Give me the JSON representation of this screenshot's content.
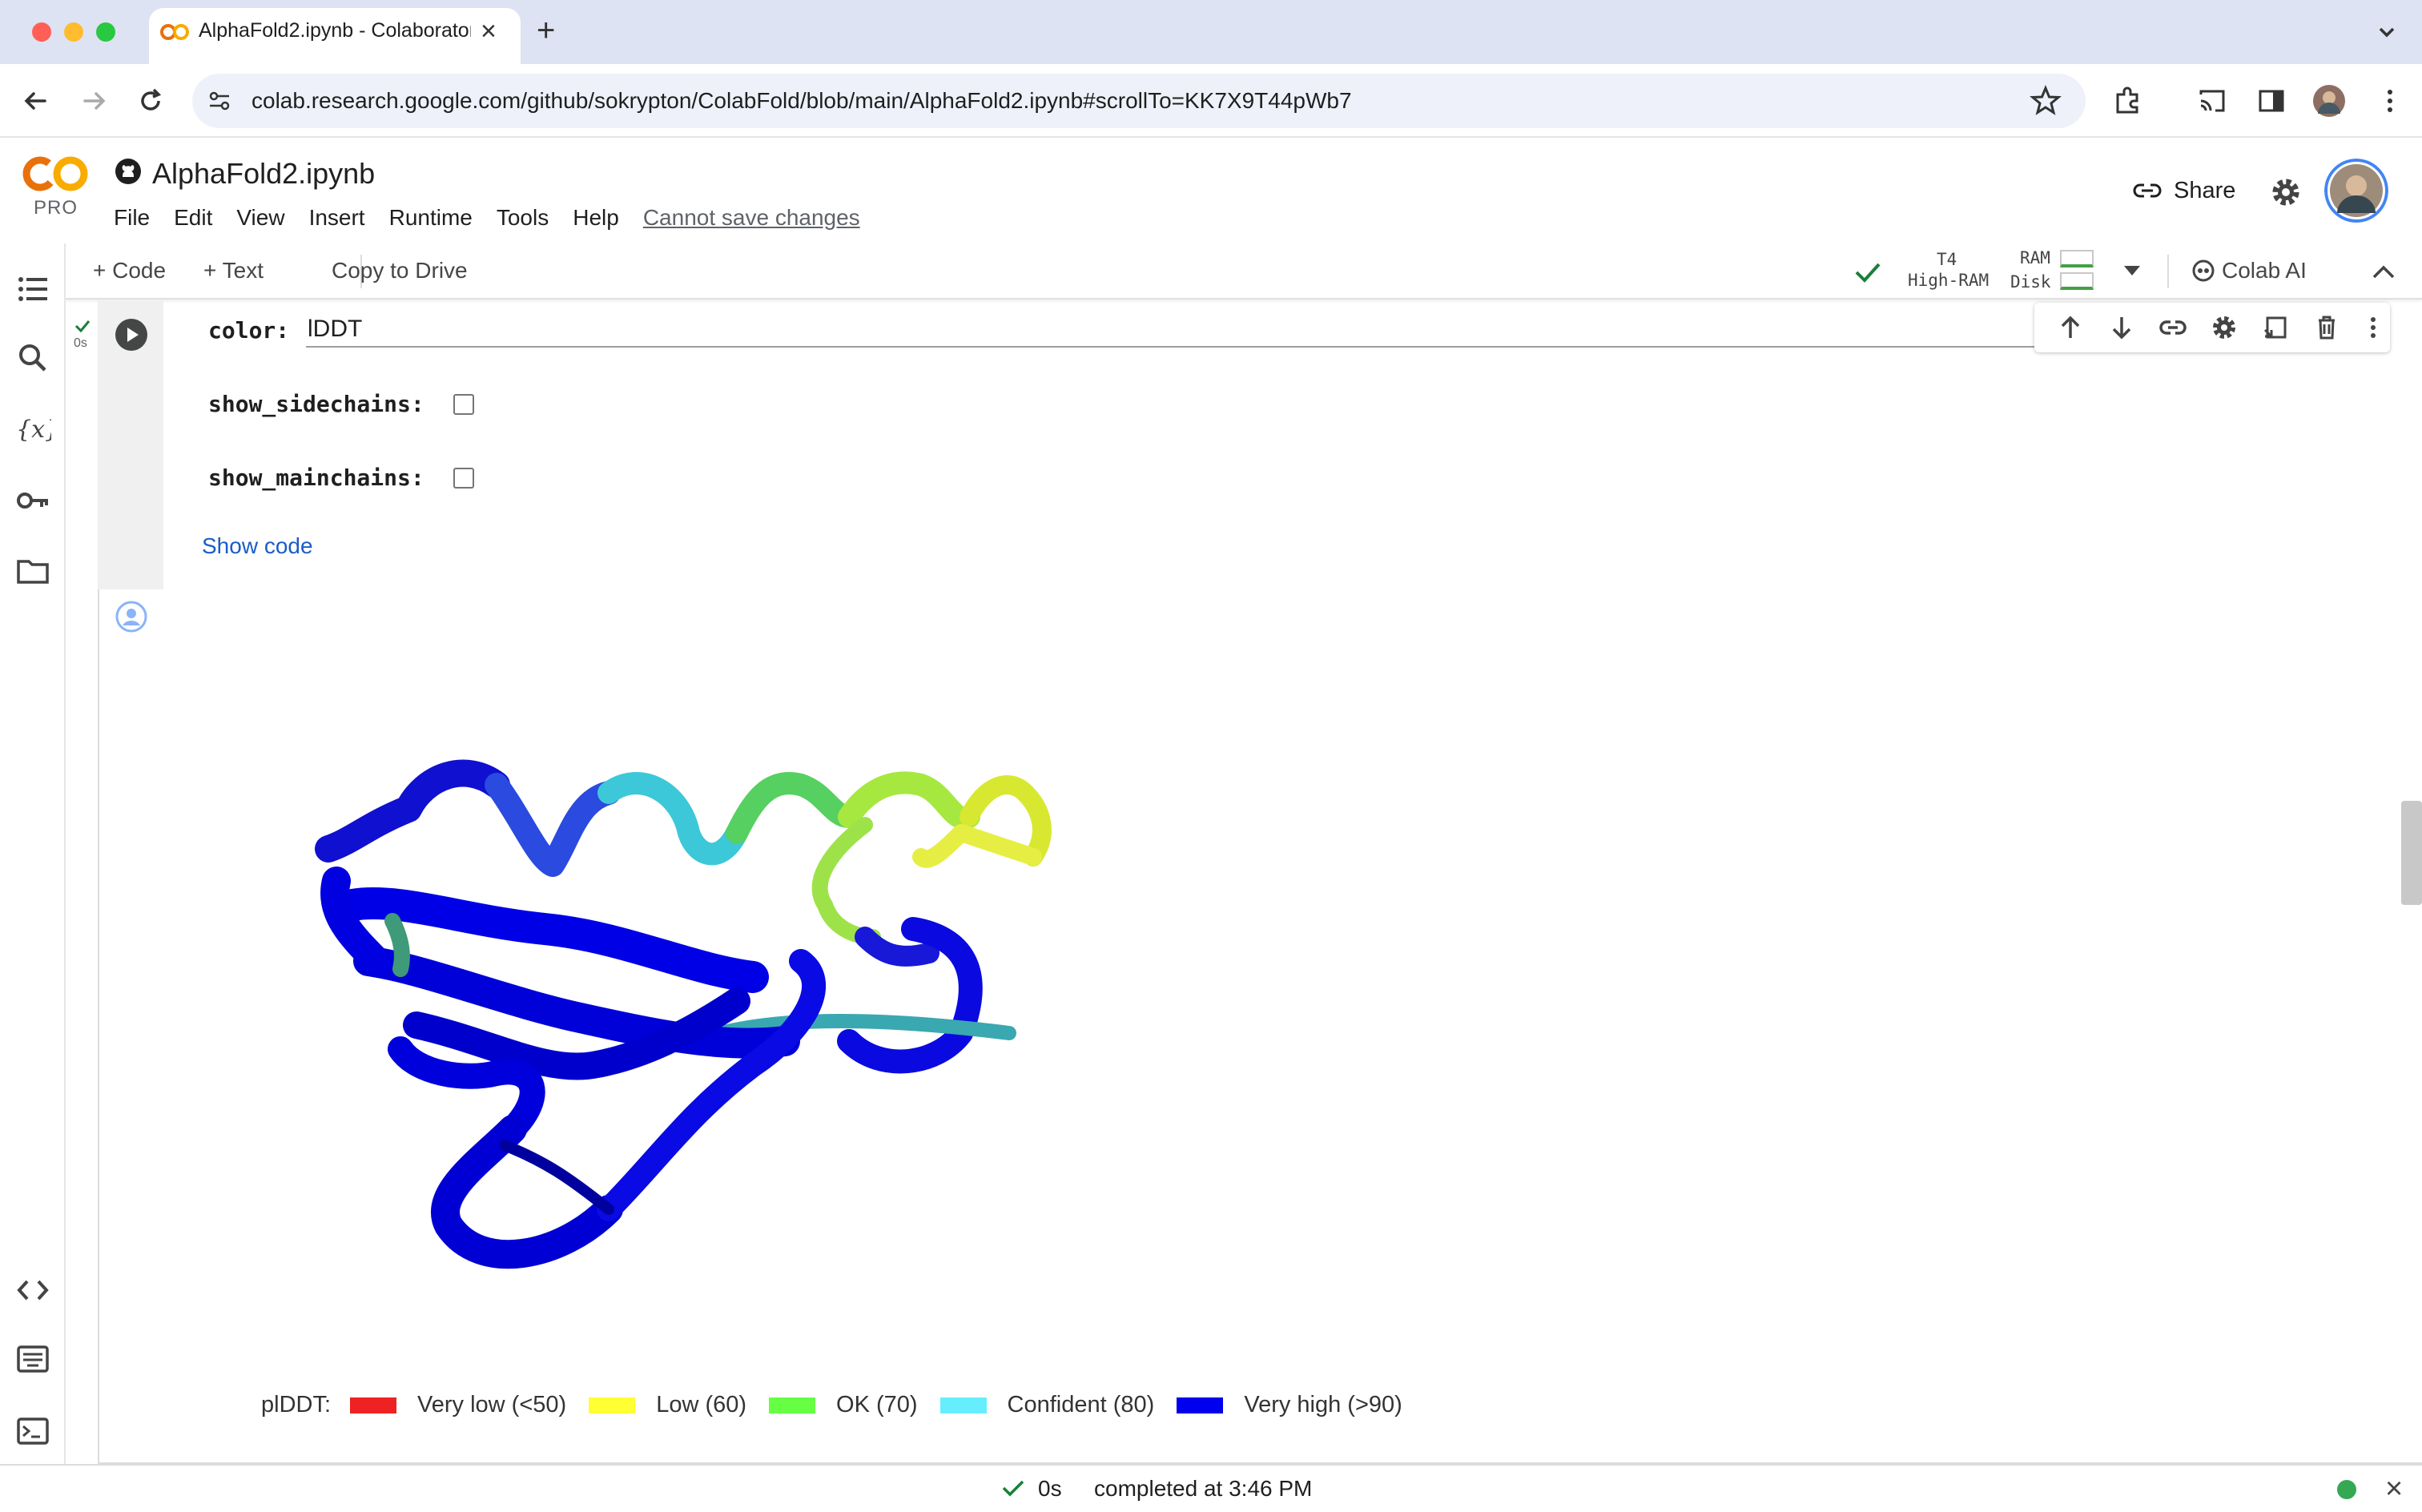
{
  "browser": {
    "tab_title": "AlphaFold2.ipynb - Colaboratory",
    "url": "colab.research.google.com/github/sokrypton/ColabFold/blob/main/AlphaFold2.ipynb#scrollTo=KK7X9T44pWb7"
  },
  "colab": {
    "logo_text": "PRO",
    "notebook_title": "AlphaFold2.ipynb",
    "menu": [
      "File",
      "Edit",
      "View",
      "Insert",
      "Runtime",
      "Tools",
      "Help"
    ],
    "save_status": "Cannot save changes",
    "share_label": "Share"
  },
  "toolbar": {
    "add_code": "+ Code",
    "add_text": "+ Text",
    "copy_to_drive": "Copy to Drive",
    "runtime_gpu": "T4",
    "runtime_ram_type": "High-RAM",
    "ram_label": "RAM",
    "disk_label": "Disk",
    "colab_ai": "Colab AI"
  },
  "cell": {
    "exec_time": "0s",
    "color_label": "color:",
    "color_value": "lDDT",
    "sidechains_label": "show_sidechains:",
    "mainchains_label": "show_mainchains:",
    "show_code": "Show code"
  },
  "legend": {
    "title": "plDDT:",
    "items": [
      {
        "label": "Very low (<50)",
        "color": "#ee2222"
      },
      {
        "label": "Low (60)",
        "color": "#ffff33"
      },
      {
        "label": "OK (70)",
        "color": "#66ff44"
      },
      {
        "label": "Confident (80)",
        "color": "#66eeff"
      },
      {
        "label": "Very high (>90)",
        "color": "#0000ee"
      }
    ]
  },
  "status": {
    "time": "0s",
    "text": "completed at 3:46 PM"
  }
}
